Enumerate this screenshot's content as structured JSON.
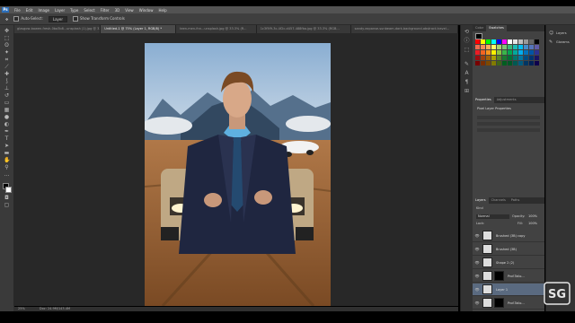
{
  "menu": [
    "File",
    "Edit",
    "Image",
    "Layer",
    "Type",
    "Select",
    "Filter",
    "3D",
    "View",
    "Window",
    "Help"
  ],
  "options": {
    "auto_select": "Auto-Select:",
    "auto_select_value": "Layer",
    "transform": "Show Transform Controls"
  },
  "tabs": [
    {
      "label": "glasgow-bowen-fresh-0ba3b8...unsplash (1).jpg @ 33.3% ...",
      "active": false
    },
    {
      "label": "Untitled-1 @ 75% (Layer 1, RGB/8) *",
      "active": true
    },
    {
      "label": "teen-men-fnn...unsplash.jpg @ 33.3% (R...",
      "active": false
    },
    {
      "label": "1c3f5f9-3c-4f2c-d457-488fba.jpg @ 33.3% (RGB...",
      "active": false
    },
    {
      "label": "sandy-expanse-sunbeam-dark-background-abstract-travel...",
      "active": false
    }
  ],
  "status": {
    "zoom": "25%",
    "doc": "Doc: 24.9M/143.4M"
  },
  "panels": {
    "color_tabs": [
      "Color",
      "Swatches"
    ],
    "props_tabs": [
      "Properties",
      "Adjustments"
    ],
    "props_title": "Pixel Layer Properties",
    "layers_tabs": [
      "Layers",
      "Channels",
      "Paths"
    ],
    "kind_label": "Kind",
    "blend_mode": "Normal",
    "opacity_label": "Opacity:",
    "opacity_value": "100%",
    "lock_label": "Lock:",
    "fill_label": "Fill:",
    "fill_value": "100%",
    "layers": [
      {
        "name": "Brushed (3B) copy",
        "selected": false,
        "mask": false
      },
      {
        "name": "Brushed (3B)",
        "selected": false,
        "mask": false
      },
      {
        "name": "Shape 2 (2)",
        "selected": false,
        "mask": false
      },
      {
        "name": "Prof.Tailo...",
        "selected": false,
        "mask": true
      },
      {
        "name": "Layer 1",
        "selected": true,
        "mask": false
      },
      {
        "name": "Prof.Tailo...",
        "selected": false,
        "mask": true
      }
    ]
  },
  "far_panel": [
    {
      "icon": "person-icon",
      "label": "Layers"
    },
    {
      "icon": "brush-icon",
      "label": "Glorams"
    }
  ],
  "colors": {
    "accent_blue": "#2a6ebb",
    "selected_layer": "#5a6a80"
  },
  "swatches": [
    "#ff0000",
    "#ffff00",
    "#00ff00",
    "#00ffff",
    "#0000ff",
    "#ff00ff",
    "#ffffff",
    "#e6e6e6",
    "#bfbfbf",
    "#999999",
    "#666666",
    "#000000",
    "#f26c4f",
    "#f68e56",
    "#fbaf5d",
    "#fff568",
    "#acd373",
    "#7cc576",
    "#3bb878",
    "#1abbb4",
    "#00bff3",
    "#438ccb",
    "#5574b9",
    "#605ca8",
    "#ed1c24",
    "#f26522",
    "#f7941d",
    "#fff200",
    "#8dc63f",
    "#39b54a",
    "#00a651",
    "#00a99d",
    "#00aeef",
    "#0072bc",
    "#0054a6",
    "#2e3192",
    "#9e0b0f",
    "#a0410d",
    "#a36209",
    "#aba000",
    "#598527",
    "#197b30",
    "#007236",
    "#00746b",
    "#0076a3",
    "#004b80",
    "#003471",
    "#1b1464",
    "#790000",
    "#7b2e00",
    "#7d4900",
    "#827b00",
    "#406618",
    "#005e20",
    "#005826",
    "#005952",
    "#005b7f",
    "#003663",
    "#002157",
    "#0d004c"
  ],
  "logo_text": "SG"
}
